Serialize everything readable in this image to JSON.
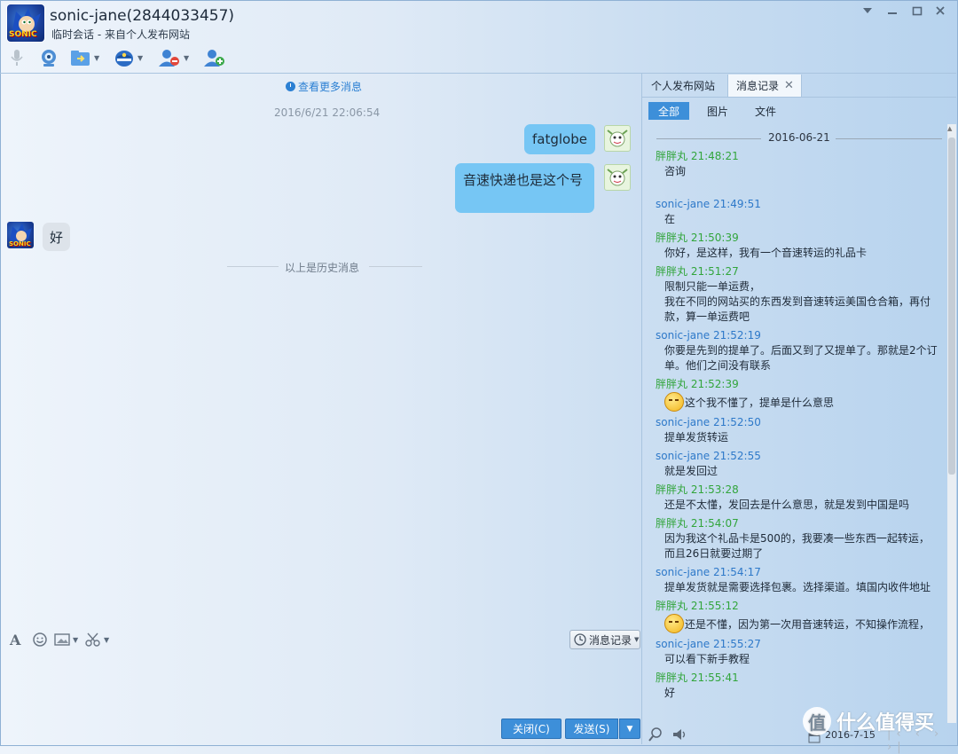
{
  "window": {
    "title": "sonic-jane(2844033457)",
    "subtitle": "临时会话 - 来自个人发布网站"
  },
  "avatar": {
    "logo_text": "SONIC"
  },
  "chat": {
    "view_more": "查看更多消息",
    "timestamp": "2016/6/21 22:06:54",
    "messages": [
      {
        "from": "self",
        "text": "fatglobe"
      },
      {
        "from": "self",
        "text": "音速快递也是这个号"
      },
      {
        "from": "other",
        "text": "好"
      }
    ],
    "history_divider": "以上是历史消息"
  },
  "input": {
    "history_button": "消息记录",
    "close_button": "关闭(C)",
    "send_button": "发送(S)"
  },
  "right_panel": {
    "tabs": [
      "个人发布网站",
      "消息记录"
    ],
    "subtabs": [
      "全部",
      "图片",
      "文件"
    ],
    "date": "2016-06-21",
    "log": [
      {
        "sender": "胖胖丸 21:48:21",
        "me": true,
        "text": "咨询"
      },
      {
        "sender": "sonic-jane 21:49:51",
        "me": false,
        "text": "在"
      },
      {
        "sender": "胖胖丸 21:50:39",
        "me": true,
        "text": "你好，是这样，我有一个音速转运的礼品卡"
      },
      {
        "sender": "胖胖丸 21:51:27",
        "me": true,
        "text": "限制只能一单运费，"
      },
      {
        "sender": "",
        "me": true,
        "text": "我在不同的网站买的东西发到音速转运美国仓合箱，再付款，算一单运费吧"
      },
      {
        "sender": "sonic-jane 21:52:19",
        "me": false,
        "text": "你要是先到的提单了。后面又到了又提单了。那就是2个订单。他们之间没有联系"
      },
      {
        "sender": "胖胖丸 21:52:39",
        "me": true,
        "text": "这个我不懂了，提单是什么意思",
        "emoji": true
      },
      {
        "sender": "sonic-jane 21:52:50",
        "me": false,
        "text": "提单发货转运"
      },
      {
        "sender": "sonic-jane 21:52:55",
        "me": false,
        "text": "就是发回过"
      },
      {
        "sender": "胖胖丸 21:53:28",
        "me": true,
        "text": "还是不太懂，发回去是什么意思，就是发到中国是吗"
      },
      {
        "sender": "胖胖丸 21:54:07",
        "me": true,
        "text": "因为我这个礼品卡是500的，我要凑一些东西一起转运，而且26日就要过期了"
      },
      {
        "sender": "sonic-jane 21:54:17",
        "me": false,
        "text": "提单发货就是需要选择包裹。选择渠道。填国内收件地址"
      },
      {
        "sender": "胖胖丸 21:55:12",
        "me": true,
        "text": "还是不懂，因为第一次用音速转运，不知操作流程，",
        "emoji": true
      },
      {
        "sender": "sonic-jane 21:55:27",
        "me": false,
        "text": "可以看下新手教程"
      },
      {
        "sender": "胖胖丸 21:55:41",
        "me": true,
        "text": "好"
      }
    ],
    "bottom_date": "2016-7-15"
  },
  "watermark": {
    "badge": "值",
    "text": "什么值得买"
  }
}
